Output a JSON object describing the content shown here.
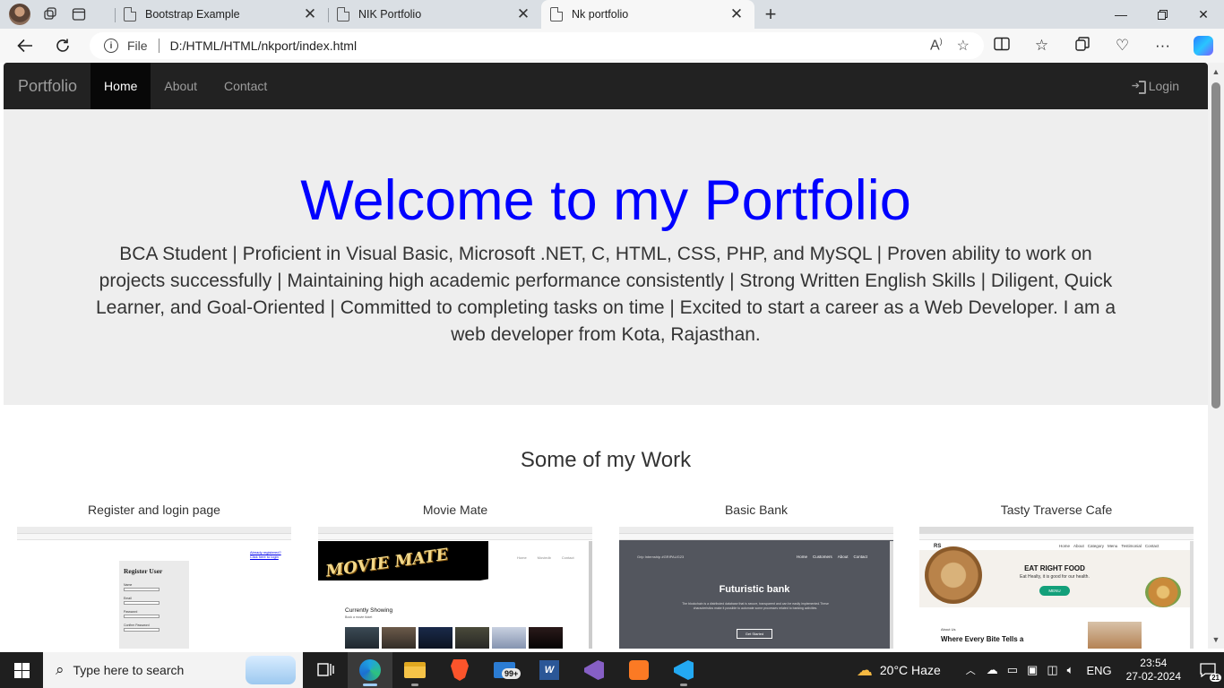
{
  "browser": {
    "tabs": [
      {
        "title": "Bootstrap Example",
        "active": false
      },
      {
        "title": "NIK Portfolio",
        "active": false
      },
      {
        "title": "Nk portfolio",
        "active": true
      }
    ],
    "address": {
      "scheme_label": "File",
      "url": "D:/HTML/HTML/nkport/index.html"
    },
    "icons": {
      "back": "back-arrow-icon",
      "refresh": "refresh-icon",
      "read_aloud": "read-aloud-icon",
      "favorite": "star-icon",
      "split": "split-screen-icon",
      "favorites": "favorites-icon",
      "collections": "collections-icon",
      "performance": "performance-icon",
      "more": "more-icon",
      "copilot": "copilot-icon"
    }
  },
  "site": {
    "navbar": {
      "brand": "Portfolio",
      "links": [
        "Home",
        "About",
        "Contact"
      ],
      "active": "Home",
      "login": "Login"
    },
    "hero": {
      "title": "Welcome to my Portfolio",
      "text": "BCA Student | Proficient in Visual Basic, Microsoft .NET, C, HTML, CSS, PHP, and MySQL | Proven ability to work on projects successfully | Maintaining high academic performance consistently | Strong Written English Skills | Diligent, Quick Learner, and Goal-Oriented | Committed to completing tasks on time | Excited to start a career as a Web Developer. I am a web developer from Kota, Rajasthan."
    },
    "work": {
      "heading": "Some of my Work",
      "projects": [
        {
          "title": "Register and login page",
          "thumb": {
            "heading": "Register User",
            "fields": [
              "Name",
              "Email",
              "Password",
              "Confirm Password"
            ],
            "link": "Already registered? Click here to login"
          }
        },
        {
          "title": "Movie Mate",
          "thumb": {
            "logo": "MOVIE MATE",
            "nav": [
              "Home",
              "Moviedb",
              "Contact"
            ],
            "section": "Currently Showing",
            "sub": "Book a movie ticket"
          }
        },
        {
          "title": "Basic Bank",
          "thumb": {
            "brand": "Grip Internship #GRIPAUG23",
            "nav": [
              "Home",
              "Customers",
              "About",
              "Contact"
            ],
            "heading": "Futuristic bank",
            "body": "The blockchain is a distributed database that is secure, transparent and can be easily implemented.These characteristics make it possible to automate some processes related to banking activities.",
            "button": "Get Started"
          }
        },
        {
          "title": "Tasty Traverse Cafe",
          "thumb": {
            "logo": "RS",
            "nav": [
              "Home",
              "About",
              "Category",
              "Menu",
              "Testimonial",
              "Contact"
            ],
            "heading": "EAT RIGHT FOOD",
            "tagline": "Eat Healty, it is good for our health.",
            "button": "MENU",
            "about_label": "About Us",
            "about_heading": "Where Every Bite Tells a"
          }
        }
      ]
    }
  },
  "taskbar": {
    "search_placeholder": "Type here to search",
    "badge": "99+",
    "weather": "20°C  Haze",
    "language": "ENG",
    "time": "23:54",
    "date": "27-02-2024",
    "notifications": "21"
  }
}
